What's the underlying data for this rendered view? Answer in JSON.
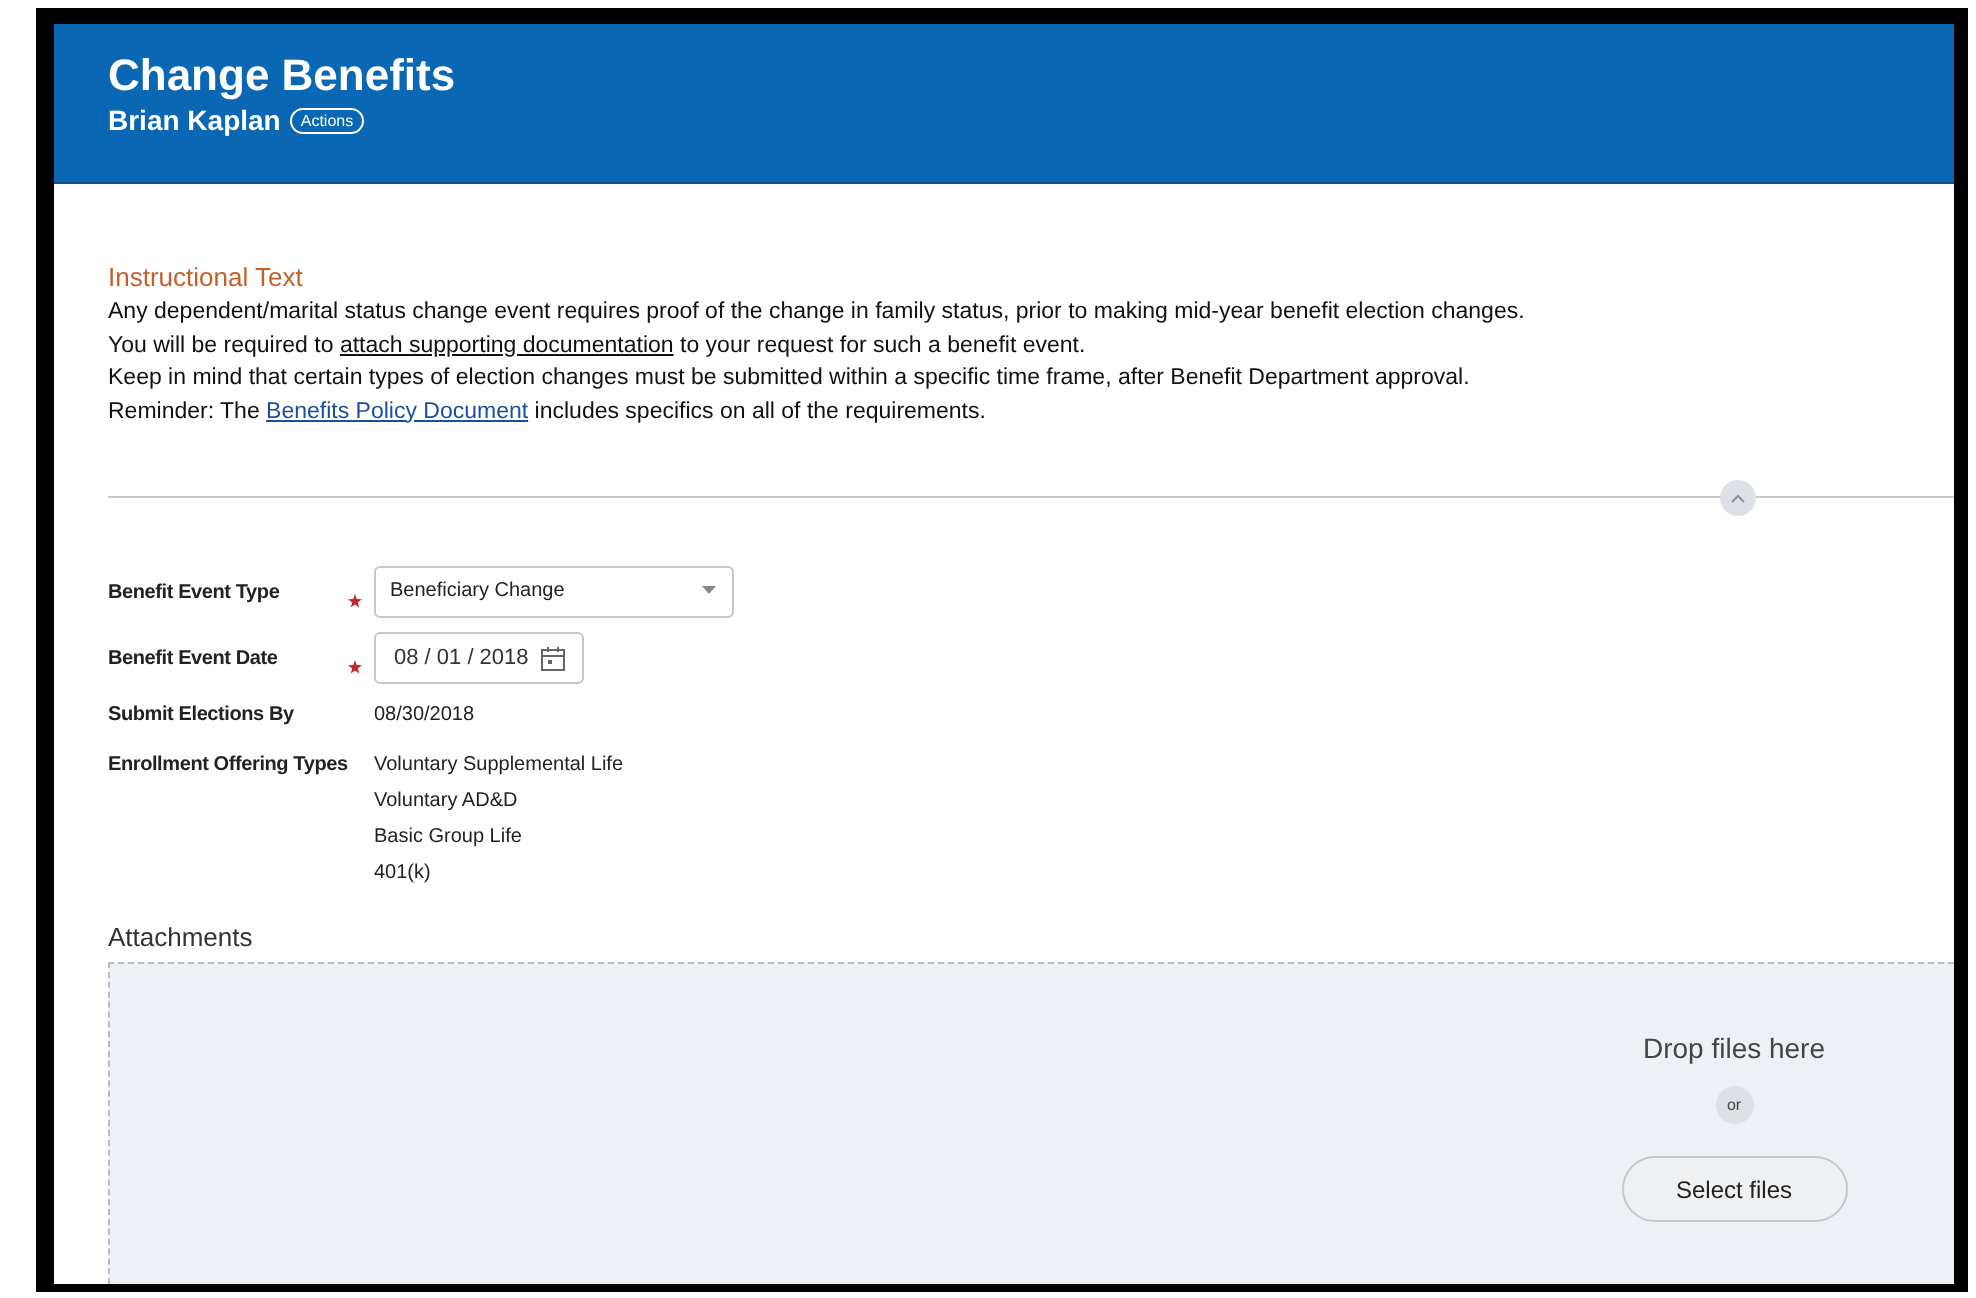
{
  "header": {
    "title": "Change Benefits",
    "subtitle": "Brian Kaplan",
    "actions_button": "Actions"
  },
  "instructions": {
    "heading": "Instructional Text",
    "lines": [
      [
        {
          "kind": "plain",
          "text": "Any dependent/marital status change event requires proof of the change in family status, prior to making mid-year benefit election changes."
        }
      ],
      [
        {
          "kind": "plain",
          "text": "You will be required to "
        },
        {
          "kind": "underline",
          "text": "attach supporting documentation"
        },
        {
          "kind": "plain",
          "text": " to your request for such a benefit event."
        }
      ],
      [
        {
          "kind": "plain",
          "text": "Keep in mind that certain types of election changes must be submitted within a specific time frame, after Benefit Department approval."
        }
      ],
      [
        {
          "kind": "plain",
          "text": "Reminder: The "
        },
        {
          "kind": "link",
          "text": "Benefits Policy Document"
        },
        {
          "kind": "plain",
          "text": " includes specifics on all of the requirements."
        }
      ]
    ]
  },
  "form": [
    {
      "kind": "select",
      "label": "Benefit Event Type",
      "required": true,
      "value": "Beneficiary Change"
    },
    {
      "kind": "date",
      "label": "Benefit Event Date",
      "required": true,
      "value": "08 / 01 / 2018"
    },
    {
      "kind": "text",
      "label": "Submit Elections By",
      "required": false,
      "values": [
        "08/30/2018"
      ]
    },
    {
      "kind": "text",
      "label": "Enrollment Offering Types",
      "required": false,
      "values": [
        "Voluntary Supplemental Life",
        "Voluntary AD&D",
        "Basic Group Life",
        "401(k)"
      ]
    }
  ],
  "attachments": {
    "heading": "Attachments",
    "drop_text": "Drop files here",
    "or_label": "or",
    "button": "Select files"
  }
}
